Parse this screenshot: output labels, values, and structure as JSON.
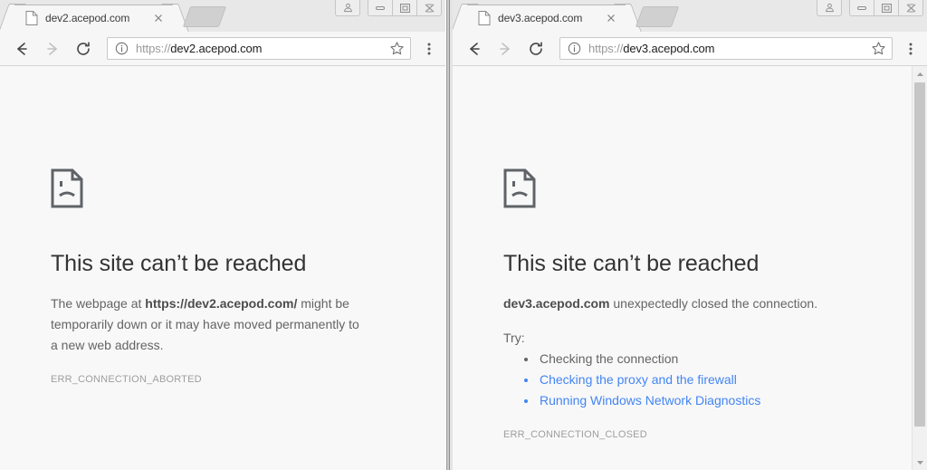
{
  "windows": [
    {
      "id": "left",
      "tab": {
        "title": "dev2.acepod.com",
        "favicon_icon": "page-icon",
        "close_icon": "close-icon",
        "newtab_label": ""
      },
      "toolbar": {
        "back_icon": "back-arrow-icon",
        "forward_icon": "forward-arrow-icon",
        "reload_icon": "reload-icon",
        "info_icon": "info-circle-icon",
        "url_scheme": "https://",
        "url_host": "dev2.acepod.com",
        "star_icon": "star-icon",
        "menu_icon": "three-dot-menu-icon"
      },
      "window_controls": {
        "profile_icon": "person-icon",
        "minimize_icon": "minimize-icon",
        "maximize_icon": "maximize-icon",
        "close_icon": "close-window-icon"
      },
      "error": {
        "icon": "sad-page-icon",
        "title": "This site can’t be reached",
        "body_pre": "The webpage at ",
        "body_strong": "https://dev2.acepod.com/",
        "body_post": " might be temporarily down or it may have moved permanently to a new web address.",
        "code": "ERR_CONNECTION_ABORTED"
      },
      "has_scrollbar": false
    },
    {
      "id": "right",
      "tab": {
        "title": "dev3.acepod.com",
        "favicon_icon": "page-icon",
        "close_icon": "close-icon",
        "newtab_label": ""
      },
      "toolbar": {
        "back_icon": "back-arrow-icon",
        "forward_icon": "forward-arrow-icon",
        "reload_icon": "reload-icon",
        "info_icon": "info-circle-icon",
        "url_scheme": "https://",
        "url_host": "dev3.acepod.com",
        "star_icon": "star-icon",
        "menu_icon": "three-dot-menu-icon"
      },
      "window_controls": {
        "profile_icon": "person-icon",
        "minimize_icon": "minimize-icon",
        "maximize_icon": "maximize-icon",
        "close_icon": "close-window-icon"
      },
      "error": {
        "icon": "sad-page-icon",
        "title": "This site can’t be reached",
        "body_strong": "dev3.acepod.com",
        "body_post": " unexpectedly closed the connection.",
        "try_label": "Try:",
        "try_items": [
          {
            "text": "Checking the connection",
            "is_link": false
          },
          {
            "text": "Checking the proxy and the firewall",
            "is_link": true
          },
          {
            "text": "Running Windows Network Diagnostics",
            "is_link": true
          }
        ],
        "code": "ERR_CONNECTION_CLOSED"
      },
      "has_scrollbar": true,
      "scrollbar": {
        "up_arrow_icon": "scroll-up-arrow-icon",
        "down_arrow_icon": "scroll-down-arrow-icon",
        "thumb_icon": "scrollbar-thumb"
      }
    }
  ],
  "colors": {
    "link": "#4285f4",
    "heading": "#333333",
    "body": "#646464",
    "code": "#9e9e9e",
    "page_bg": "#f8f8f8",
    "chrome_bg": "#f6f6f6",
    "tabstrip_bg": "#e8e8e8"
  }
}
